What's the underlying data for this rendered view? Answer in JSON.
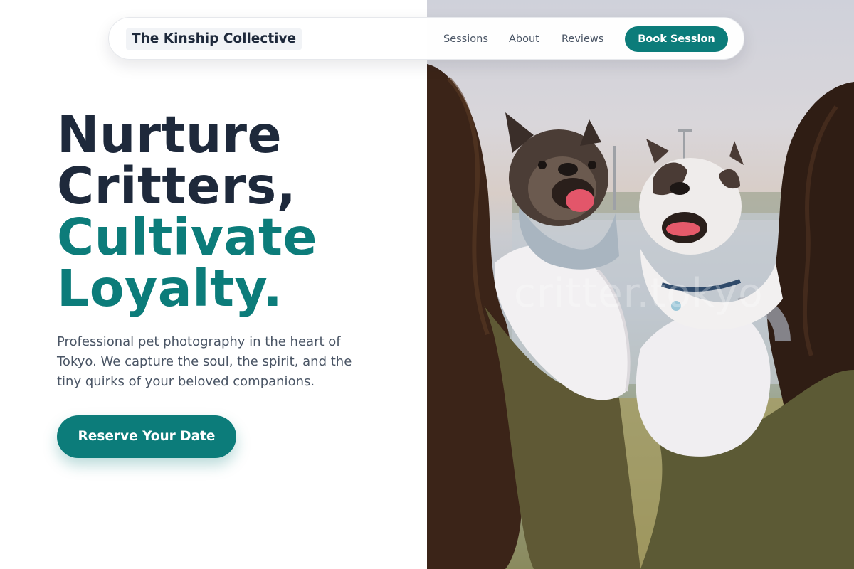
{
  "nav": {
    "brand": "The Kinship Collective",
    "links": [
      "Sessions",
      "About",
      "Reviews"
    ],
    "book_label": "Book Session"
  },
  "hero": {
    "headline_dark": [
      "Nurture",
      "Critters,"
    ],
    "headline_accent": [
      "Cultivate",
      "Loyalty."
    ],
    "description": "Professional pet photography in the heart of Tokyo. We capture the soul, the spirit, and the tiny quirks of your beloved companions.",
    "cta_label": "Reserve Your Date",
    "image_watermark": "critter.tokyo"
  },
  "colors": {
    "accent": "#0c7c7a",
    "heading": "#1e293b",
    "body_text": "#4a5565"
  },
  "icons": {
    "hero_image": "two-french-bulldogs-photo"
  }
}
